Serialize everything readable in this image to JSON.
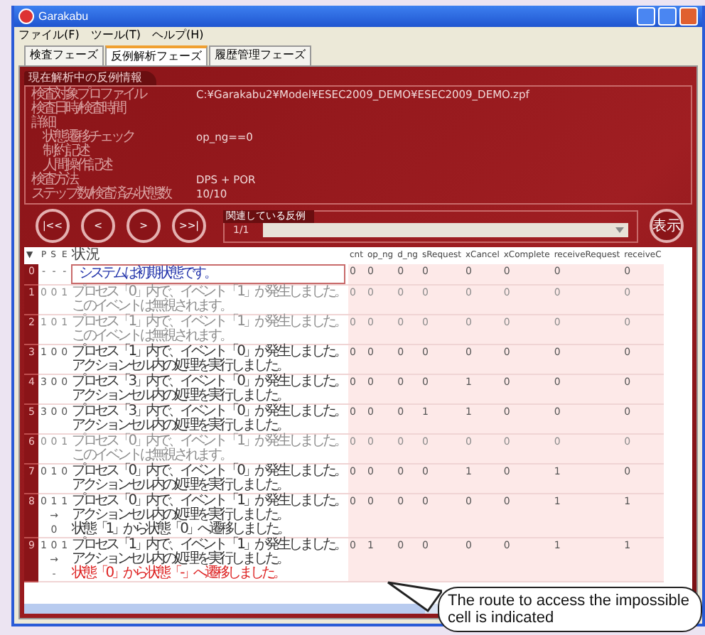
{
  "window": {
    "title": "Garakabu"
  },
  "menu": [
    "ファイル(F)",
    "ツール(T)",
    "ヘルプ(H)"
  ],
  "tabs": [
    {
      "label": "検査フェーズ",
      "selected": false
    },
    {
      "label": "反例解析フェーズ",
      "selected": true
    },
    {
      "label": "履歴管理フェーズ",
      "selected": false
    }
  ],
  "info_panel": {
    "title": "現在解析中の反例情報",
    "fields": [
      {
        "label": "検査対象プロファイル",
        "value": "C:¥Garakabu2¥Model¥ESEC2009_DEMO¥ESEC2009_DEMO.zpf"
      },
      {
        "label": "検査日時/検査時間"
      },
      {
        "label": "詳細"
      },
      {
        "label": "　状態遷移チェック",
        "value": "op_ng==0"
      },
      {
        "label": "　制約記述"
      },
      {
        "label": "　人間操作記述"
      },
      {
        "label": "検査方法",
        "value": "DPS + POR"
      },
      {
        "label": "ステップ数/検査済み状態数",
        "value": "10/10"
      }
    ]
  },
  "nav_buttons": [
    "|<<",
    "<",
    ">",
    ">>|"
  ],
  "related": {
    "title": "関連している反例",
    "counter": "1/1",
    "button": "表示"
  },
  "table": {
    "columns": [
      "▼",
      "P",
      "S",
      "E",
      "状況",
      "cnt",
      "op_ng",
      "d_ng",
      "sRequest",
      "xCancel",
      "xComplete",
      "receiveRequest",
      "receiveC"
    ],
    "rows": [
      {
        "index": "0",
        "faded": false,
        "p": "-",
        "s": [
          "-"
        ],
        "e": "-",
        "lines": [
          {
            "text": "システムは初期状態です。",
            "kind": "info"
          }
        ],
        "values": [
          "0",
          "0",
          "0",
          "0",
          "0",
          "0",
          "0",
          "0"
        ]
      },
      {
        "index": "1",
        "faded": true,
        "p": "0",
        "s": [
          "0"
        ],
        "e": "1",
        "lines": [
          {
            "text": "プロセス「0」内で、イベント「1」が発生しました。",
            "kind": "normal"
          },
          {
            "text": "このイベントは無視されます。",
            "kind": "normal"
          }
        ],
        "values": [
          "0",
          "0",
          "0",
          "0",
          "0",
          "0",
          "0",
          "0"
        ]
      },
      {
        "index": "2",
        "faded": true,
        "p": "1",
        "s": [
          "0"
        ],
        "e": "1",
        "lines": [
          {
            "text": "プロセス「1」内で、イベント「1」が発生しました。",
            "kind": "normal"
          },
          {
            "text": "このイベントは無視されます。",
            "kind": "normal"
          }
        ],
        "values": [
          "0",
          "0",
          "0",
          "0",
          "0",
          "0",
          "0",
          "0"
        ]
      },
      {
        "index": "3",
        "faded": false,
        "p": "1",
        "s": [
          "0"
        ],
        "e": "0",
        "lines": [
          {
            "text": "プロセス「1」内で、イベント「0」が発生しました。",
            "kind": "normal"
          },
          {
            "text": "アクションセル内の処理を実行しました。",
            "kind": "normal"
          }
        ],
        "values": [
          "0",
          "0",
          "0",
          "0",
          "0",
          "0",
          "0",
          "0"
        ]
      },
      {
        "index": "4",
        "faded": false,
        "p": "3",
        "s": [
          "0"
        ],
        "e": "0",
        "lines": [
          {
            "text": "プロセス「3」内で、イベント「0」が発生しました。",
            "kind": "normal"
          },
          {
            "text": "アクションセル内の処理を実行しました。",
            "kind": "normal"
          }
        ],
        "values": [
          "0",
          "0",
          "0",
          "0",
          "1",
          "0",
          "0",
          "0"
        ]
      },
      {
        "index": "5",
        "faded": false,
        "p": "3",
        "s": [
          "0"
        ],
        "e": "0",
        "lines": [
          {
            "text": "プロセス「3」内で、イベント「0」が発生しました。",
            "kind": "normal"
          },
          {
            "text": "アクションセル内の処理を実行しました。",
            "kind": "normal"
          }
        ],
        "values": [
          "0",
          "0",
          "0",
          "1",
          "1",
          "0",
          "0",
          "0"
        ]
      },
      {
        "index": "6",
        "faded": true,
        "p": "0",
        "s": [
          "0"
        ],
        "e": "1",
        "lines": [
          {
            "text": "プロセス「0」内で、イベント「1」が発生しました。",
            "kind": "normal"
          },
          {
            "text": "このイベントは無視されます。",
            "kind": "normal"
          }
        ],
        "values": [
          "0",
          "0",
          "0",
          "0",
          "0",
          "0",
          "0",
          "0"
        ]
      },
      {
        "index": "7",
        "faded": false,
        "p": "0",
        "s": [
          "1"
        ],
        "e": "0",
        "lines": [
          {
            "text": "プロセス「0」内で、イベント「0」が発生しました。",
            "kind": "normal"
          },
          {
            "text": "アクションセル内の処理を実行しました。",
            "kind": "normal"
          }
        ],
        "values": [
          "0",
          "0",
          "0",
          "0",
          "1",
          "0",
          "1",
          "0"
        ]
      },
      {
        "index": "8",
        "faded": false,
        "p": "0",
        "s": [
          "1",
          "→",
          "0"
        ],
        "e": "1",
        "lines": [
          {
            "text": "プロセス「0」内で、イベント「1」が発生しました。",
            "kind": "normal"
          },
          {
            "text": "アクションセル内の処理を実行しました。",
            "kind": "normal"
          },
          {
            "text": "状態「1」から状態「0」へ遷移しました。",
            "kind": "normal"
          }
        ],
        "values": [
          "0",
          "0",
          "0",
          "0",
          "0",
          "0",
          "1",
          "1"
        ]
      },
      {
        "index": "9",
        "faded": false,
        "p": "1",
        "s": [
          "0",
          "→",
          "-"
        ],
        "e": "1",
        "lines": [
          {
            "text": "プロセス「1」内で、イベント「1」が発生しました。",
            "kind": "normal"
          },
          {
            "text": "アクションセル内の処理を実行しました。",
            "kind": "normal"
          },
          {
            "text": "状態「0」から状態「-」へ遷移しました。",
            "kind": "error"
          }
        ],
        "values": [
          "0",
          "1",
          "0",
          "0",
          "0",
          "0",
          "1",
          "1"
        ]
      }
    ]
  },
  "callout": "The route to access the impossible cell is indicated"
}
